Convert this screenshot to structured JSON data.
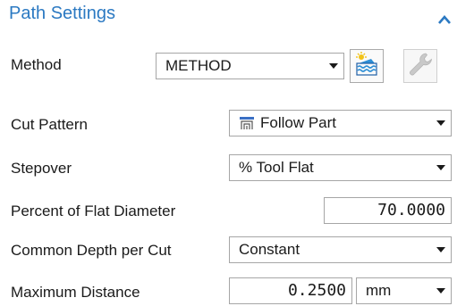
{
  "header": {
    "title": "Path Settings"
  },
  "method": {
    "label": "Method",
    "value": "METHOD"
  },
  "cut_pattern": {
    "label": "Cut Pattern",
    "value": "Follow Part"
  },
  "stepover": {
    "label": "Stepover",
    "value": "% Tool Flat"
  },
  "percent_flat": {
    "label": "Percent of Flat Diameter",
    "value": "70.0000"
  },
  "depth_per_cut": {
    "label": "Common Depth per Cut",
    "value": "Constant"
  },
  "max_distance": {
    "label": "Maximum Distance",
    "value": "0.2500",
    "unit": "mm"
  },
  "icons": {
    "collapse": "chevron-up-icon",
    "edit_method": "method-edit-icon",
    "wrench": "wrench-icon",
    "pattern": "follow-part-pattern-icon"
  },
  "colors": {
    "accent": "#2b79c2"
  }
}
